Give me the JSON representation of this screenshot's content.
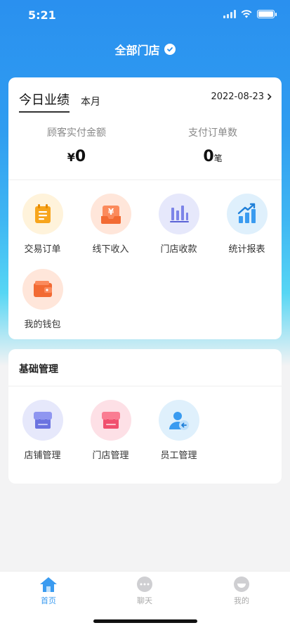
{
  "status_bar": {
    "time": "5:21"
  },
  "header": {
    "store_selector": "全部门店"
  },
  "performance": {
    "tabs": [
      {
        "label": "今日业绩",
        "active": true
      },
      {
        "label": "本月",
        "active": false
      }
    ],
    "date": "2022-08-23",
    "stats": [
      {
        "label": "顾客实付金额",
        "prefix": "¥",
        "value": "0",
        "unit": ""
      },
      {
        "label": "支付订单数",
        "prefix": "",
        "value": "0",
        "unit": "笔"
      }
    ],
    "menu": [
      {
        "label": "交易订单",
        "icon": "order-clipboard-icon"
      },
      {
        "label": "线下收入",
        "icon": "yen-tray-icon"
      },
      {
        "label": "门店收款",
        "icon": "bar-chart-icon"
      },
      {
        "label": "统计报表",
        "icon": "trend-report-icon"
      },
      {
        "label": "我的钱包",
        "icon": "wallet-icon"
      }
    ]
  },
  "basic": {
    "title": "基础管理",
    "items": [
      {
        "label": "店铺管理",
        "icon": "shop-awning-icon"
      },
      {
        "label": "门店管理",
        "icon": "store-front-icon"
      },
      {
        "label": "员工管理",
        "icon": "staff-icon"
      }
    ]
  },
  "tabbar": [
    {
      "label": "首页",
      "icon": "home-icon",
      "active": true
    },
    {
      "label": "聊天",
      "icon": "chat-icon",
      "active": false
    },
    {
      "label": "我的",
      "icon": "profile-icon",
      "active": false
    }
  ],
  "colors": {
    "accent": "#2a90ef",
    "active_tab": "#3a9bf0",
    "inactive_tab": "#aaaaaa"
  }
}
